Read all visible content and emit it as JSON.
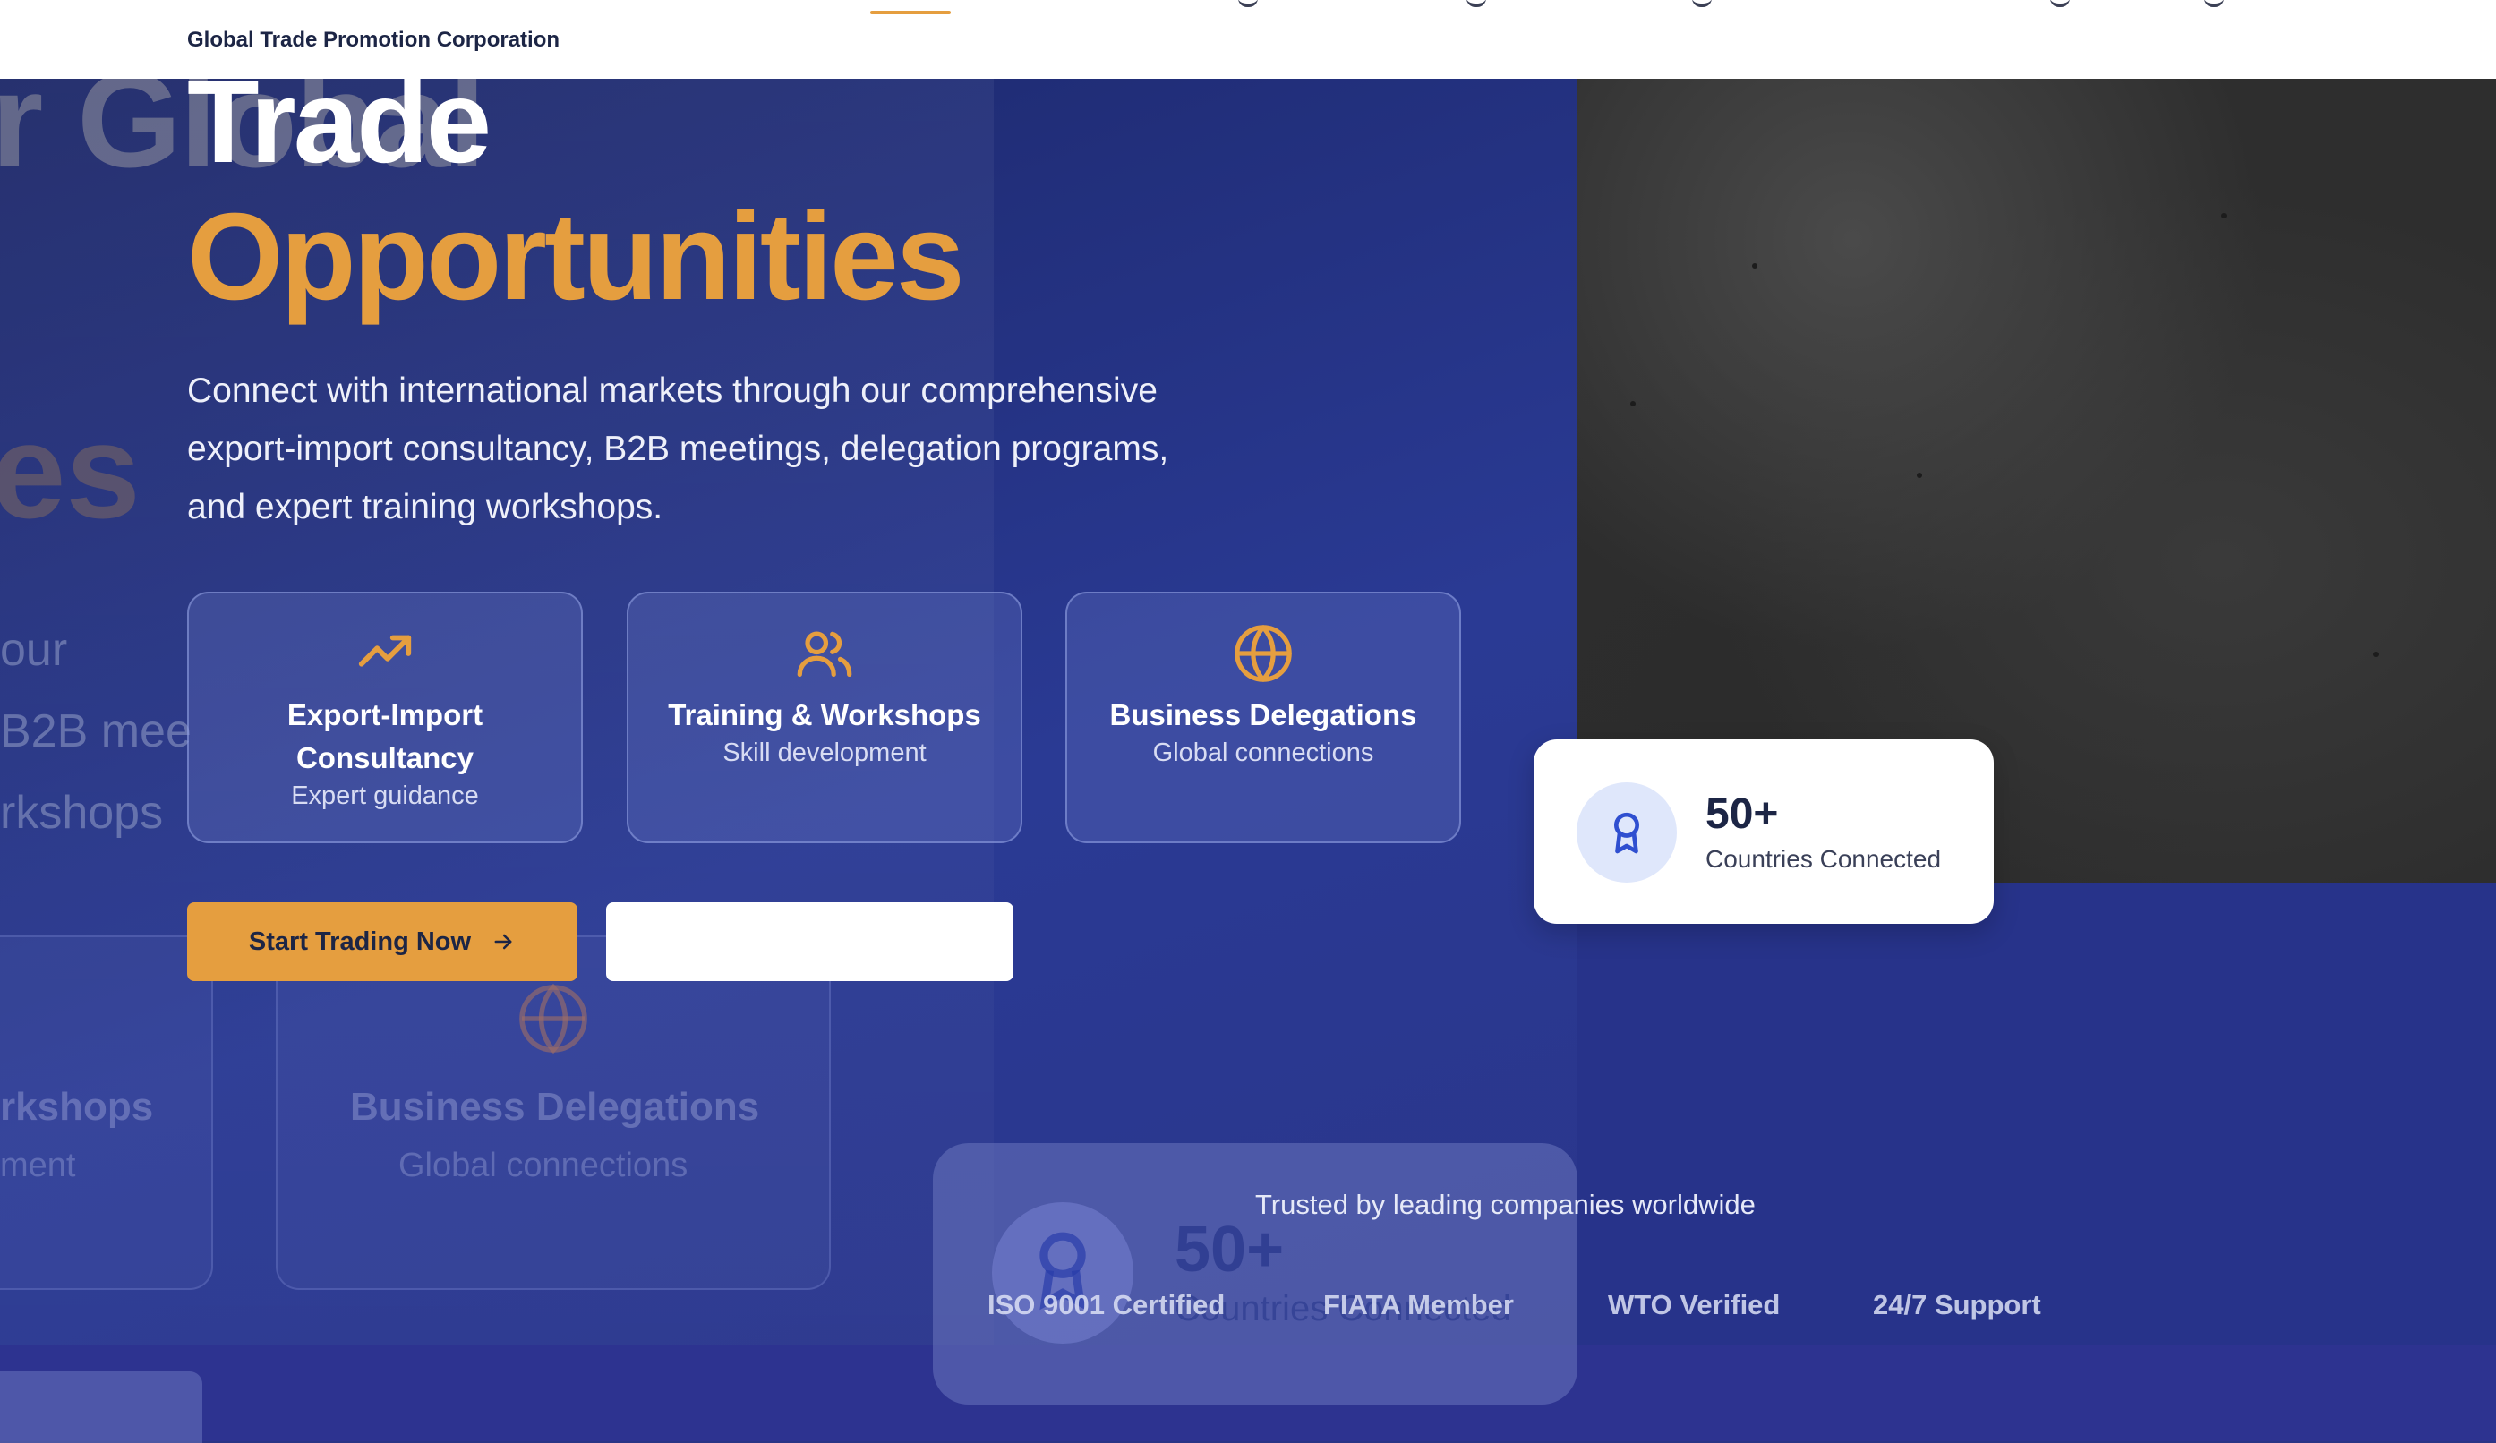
{
  "header": {
    "brand_name": "Global Trade Promotion Corporation"
  },
  "hero": {
    "title_line_1": "Trade",
    "title_line_2": "Opportunities",
    "description": "Connect with international markets through our comprehensive export-import consultancy, B2B meetings, delegation programs, and expert training workshops."
  },
  "features": [
    {
      "title": "Export-Import Consultancy",
      "subtitle": "Expert guidance",
      "icon": "trending-up-icon"
    },
    {
      "title": "Training & Workshops",
      "subtitle": "Skill development",
      "icon": "users-icon"
    },
    {
      "title": "Business Delegations",
      "subtitle": "Global connections",
      "icon": "globe-icon"
    }
  ],
  "buttons": {
    "primary_label": "Start Trading Now",
    "primary_icon": "arrow-right-icon"
  },
  "stat": {
    "value": "50+",
    "label": "Countries Connected",
    "icon": "award-icon"
  },
  "trust": {
    "heading": "Trusted by leading companies worldwide",
    "items": [
      "ISO 9001 Certified",
      "FIATA Member",
      "WTO Verified",
      "24/7 Support"
    ]
  },
  "ghost": {
    "title_fragment": "r Global",
    "title_fragment_2": "es",
    "desc_fragments": [
      "our",
      "B2B mee",
      "rkshops"
    ],
    "card_1_title": "rkshops",
    "card_1_sub": "ment",
    "card_2_title": "Business Delegations",
    "card_2_sub": "Global connections",
    "stat_value": "50+",
    "stat_label": "Countries Connected"
  },
  "colors": {
    "accent": "#e59e3f",
    "navy": "#1c2545",
    "hero_blue": "#2a3a94"
  }
}
